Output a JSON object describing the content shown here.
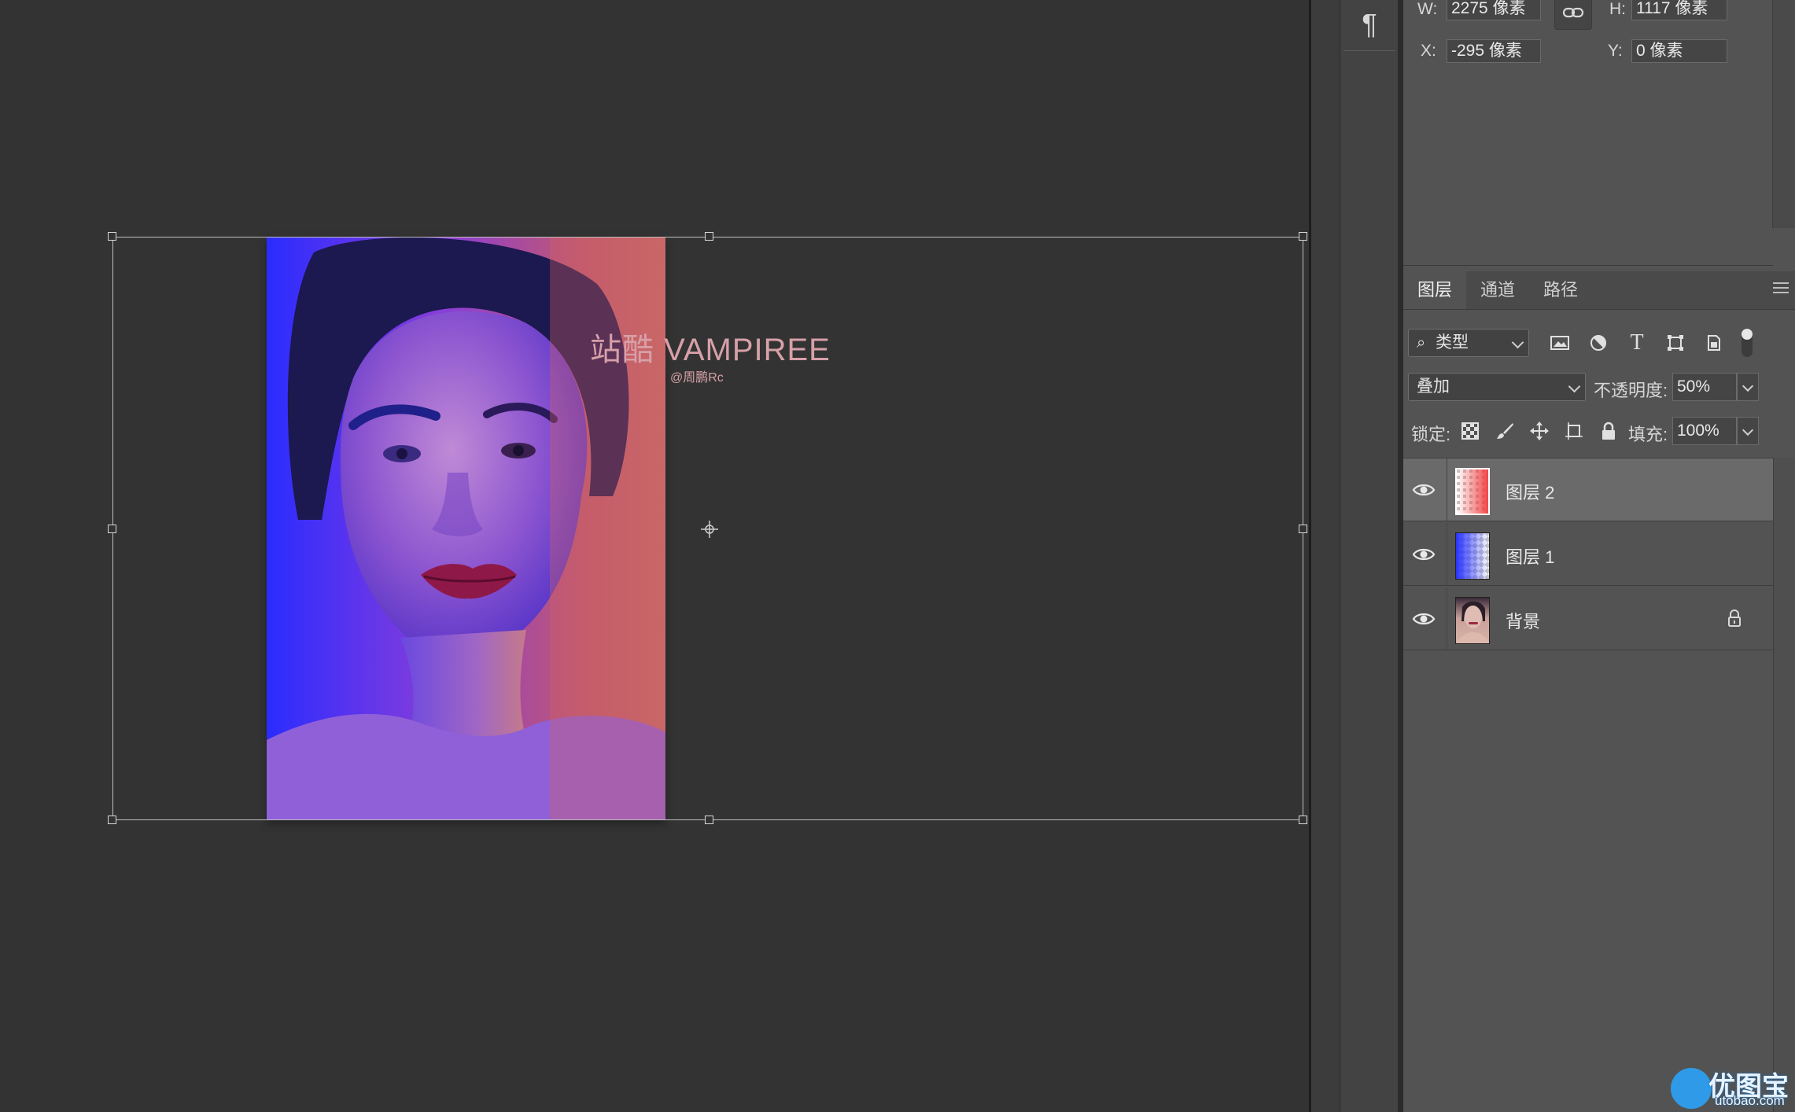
{
  "canvas": {
    "overlay_title": "站酷 VAMPIREE",
    "overlay_subtitle": "@周鹏Rc"
  },
  "sidebar_strip": {
    "paragraph_icon": "¶"
  },
  "properties": {
    "w_label": "W:",
    "w_value": "2275 像素",
    "h_label": "H:",
    "h_value": "1117 像素",
    "x_label": "X:",
    "x_value": "-295 像素",
    "y_label": "Y:",
    "y_value": "0 像素",
    "link_icon": "link-icon"
  },
  "layers_panel": {
    "tabs": [
      {
        "label": "图层"
      },
      {
        "label": "通道"
      },
      {
        "label": "路径"
      }
    ],
    "filter": {
      "value": "类型",
      "icon": "search-icon"
    },
    "filter_icons": [
      "image-filter-icon",
      "adjustment-filter-icon",
      "type-filter-icon",
      "shape-filter-icon",
      "smart-object-filter-icon",
      "filter-toggle"
    ],
    "blend_mode": "叠加",
    "opacity_label": "不透明度:",
    "opacity_value": "50%",
    "lock_label": "锁定:",
    "fill_label": "填充:",
    "fill_value": "100%",
    "layers": [
      {
        "name": "图层 2",
        "selected": true,
        "thumb": "red-gradient"
      },
      {
        "name": "图层 1",
        "selected": false,
        "thumb": "blue-gradient"
      },
      {
        "name": "背景",
        "selected": false,
        "thumb": "portrait",
        "locked": true
      }
    ]
  },
  "watermark": {
    "text": "优图宝",
    "site": "utobao.com"
  },
  "colors": {
    "panel_bg": "#535353",
    "selected_layer": "#6a6a6a",
    "canvas_bg": "#333333"
  }
}
